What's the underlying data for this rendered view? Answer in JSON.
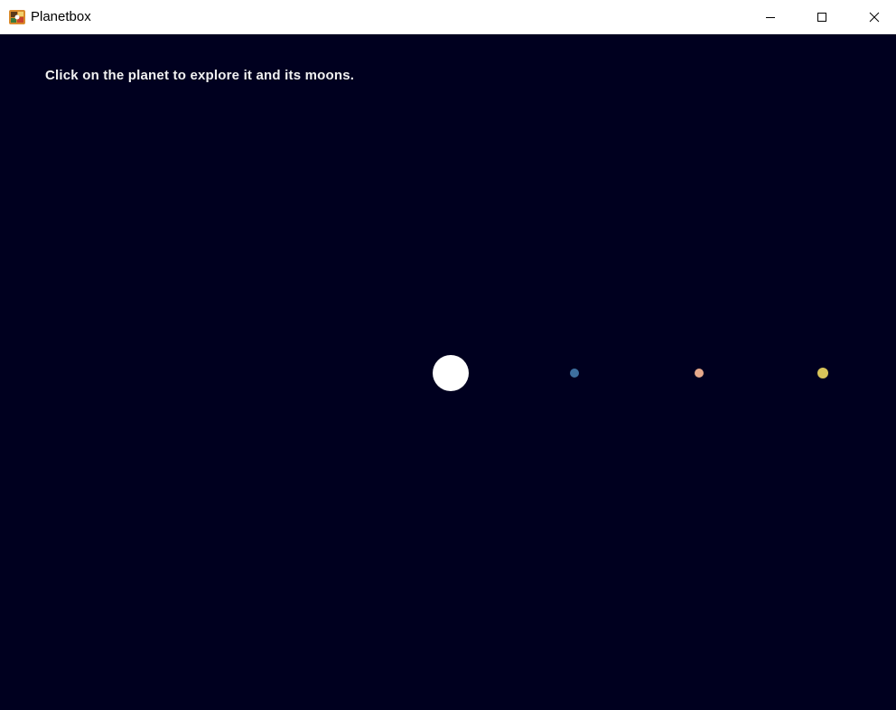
{
  "window": {
    "title": "Planetbox"
  },
  "game": {
    "instruction": "Click on the planet to explore it and its moons.",
    "background_color": "#00001f",
    "planet": {
      "color": "#ffffff"
    },
    "moons": [
      {
        "color": "#3d6f9e"
      },
      {
        "color": "#e6a98a"
      },
      {
        "color": "#d8c45a"
      }
    ]
  }
}
